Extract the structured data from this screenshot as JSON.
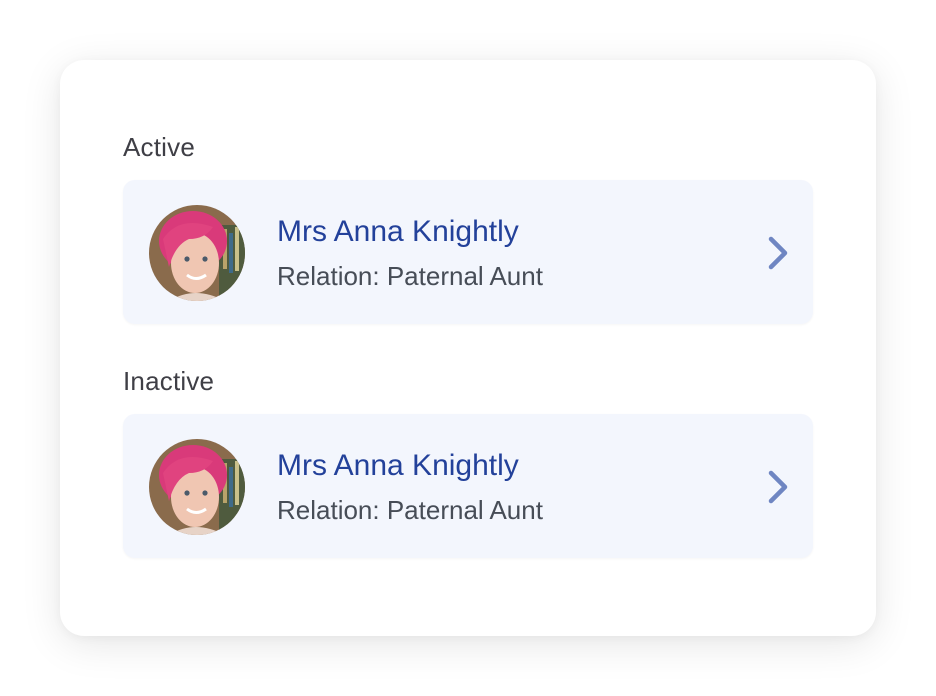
{
  "sections": [
    {
      "label": "Active",
      "contact": {
        "name": "Mrs Anna Knightly",
        "relation": "Relation: Paternal Aunt",
        "avatar_icon": "avatar-photo",
        "chevron_icon": "chevron-right-icon"
      }
    },
    {
      "label": "Inactive",
      "contact": {
        "name": "Mrs Anna Knightly",
        "relation": "Relation: Paternal Aunt",
        "avatar_icon": "avatar-photo",
        "chevron_icon": "chevron-right-icon"
      }
    }
  ],
  "colors": {
    "name_text": "#23419a",
    "row_background": "#f3f6fd",
    "chevron": "#6f86c2",
    "label_text": "#3f3f46"
  }
}
